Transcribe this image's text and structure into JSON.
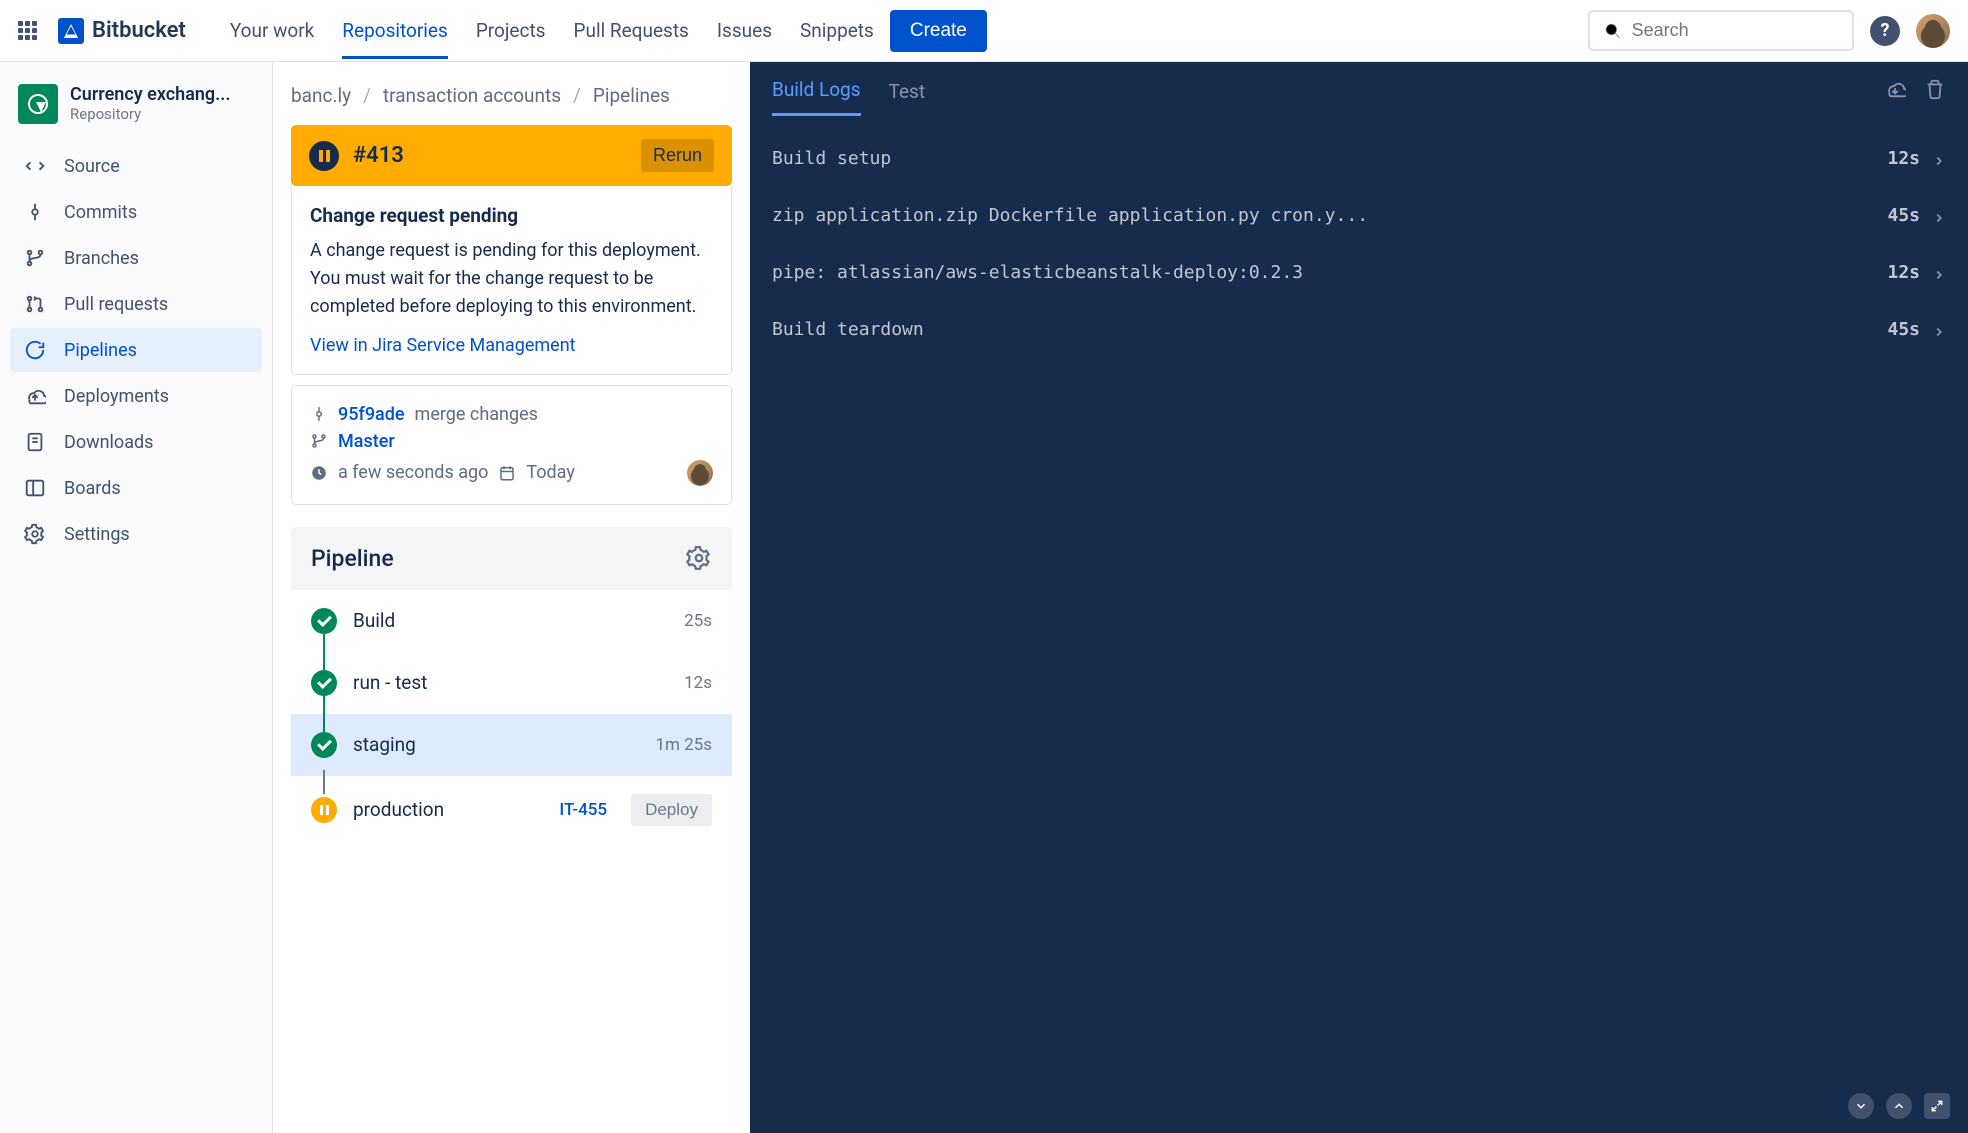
{
  "header": {
    "product_name": "Bitbucket",
    "nav": {
      "your_work": "Your work",
      "repositories": "Repositories",
      "projects": "Projects",
      "pull_requests": "Pull Requests",
      "issues": "Issues",
      "snippets": "Snippets"
    },
    "create_label": "Create",
    "search_placeholder": "Search"
  },
  "sidebar": {
    "repo_name": "Currency exchang...",
    "repo_sub": "Repository",
    "items": [
      {
        "label": "Source"
      },
      {
        "label": "Commits"
      },
      {
        "label": "Branches"
      },
      {
        "label": "Pull requests"
      },
      {
        "label": "Pipelines"
      },
      {
        "label": "Deployments"
      },
      {
        "label": "Downloads"
      },
      {
        "label": "Boards"
      },
      {
        "label": "Settings"
      }
    ]
  },
  "breadcrumb": {
    "a": "banc.ly",
    "b": "transaction accounts",
    "c": "Pipelines"
  },
  "build": {
    "number": "#413",
    "rerun_label": "Rerun",
    "cr_title": "Change request pending",
    "cr_text": "A change request is pending for this deployment. You must wait for the change request to be completed before deploying to this environment.",
    "cr_link": "View in Jira Service Management",
    "commit_hash": "95f9ade",
    "commit_msg": "merge changes",
    "branch": "Master",
    "time_ago": "a few seconds ago",
    "date": "Today"
  },
  "pipeline": {
    "title": "Pipeline",
    "stages": [
      {
        "name": "Build",
        "time": "25s"
      },
      {
        "name": "run - test",
        "time": "12s"
      },
      {
        "name": "staging",
        "time": "1m 25s"
      },
      {
        "name": "production",
        "issue": "IT-455",
        "deploy_label": "Deploy"
      }
    ]
  },
  "logs": {
    "tabs": {
      "build_logs": "Build Logs",
      "test": "Test"
    },
    "lines": [
      {
        "text": "Build setup",
        "time": "12s"
      },
      {
        "text": "zip application.zip Dockerfile application.py cron.y...",
        "time": "45s"
      },
      {
        "text": "pipe: atlassian/aws-elasticbeanstalk-deploy:0.2.3",
        "time": "12s"
      },
      {
        "text": "Build teardown",
        "time": "45s"
      }
    ]
  }
}
